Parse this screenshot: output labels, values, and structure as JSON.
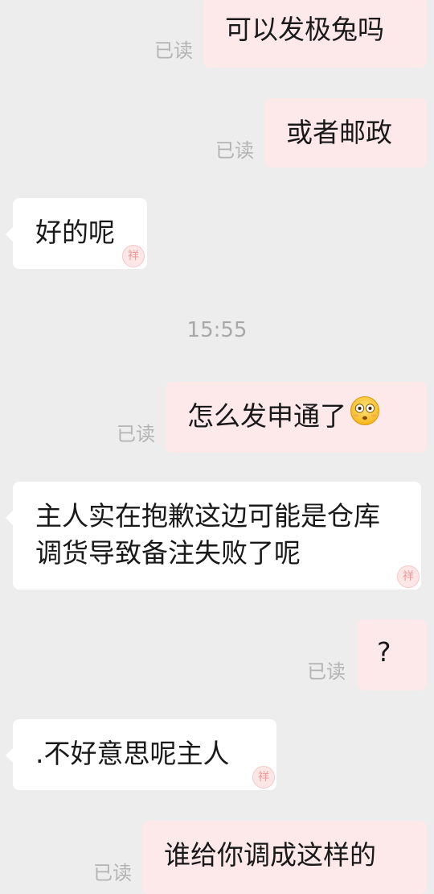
{
  "conversation": {
    "read_label": "已读",
    "messages": [
      {
        "text": "可以发极兔吗"
      },
      {
        "text": "或者邮政"
      },
      {
        "text": "好的呢"
      },
      {
        "text": "怎么发申通了"
      },
      {
        "text": "主人实在抱歉这边可能是仓库调货导致备注失败了呢"
      },
      {
        "text": "?"
      },
      {
        "text": ".不好意思呢主人"
      },
      {
        "text": "谁给你调成这样的"
      }
    ],
    "timestamp": "15:55",
    "seal_text": "祥"
  },
  "colors": {
    "background": "#ededed",
    "outgoing_bubble": "#fde9e9",
    "incoming_bubble": "#ffffff",
    "read_label": "#b4b4b4"
  },
  "icons": {
    "emoji": "flushed-face-emoji",
    "seal": "red-seal-stamp"
  }
}
